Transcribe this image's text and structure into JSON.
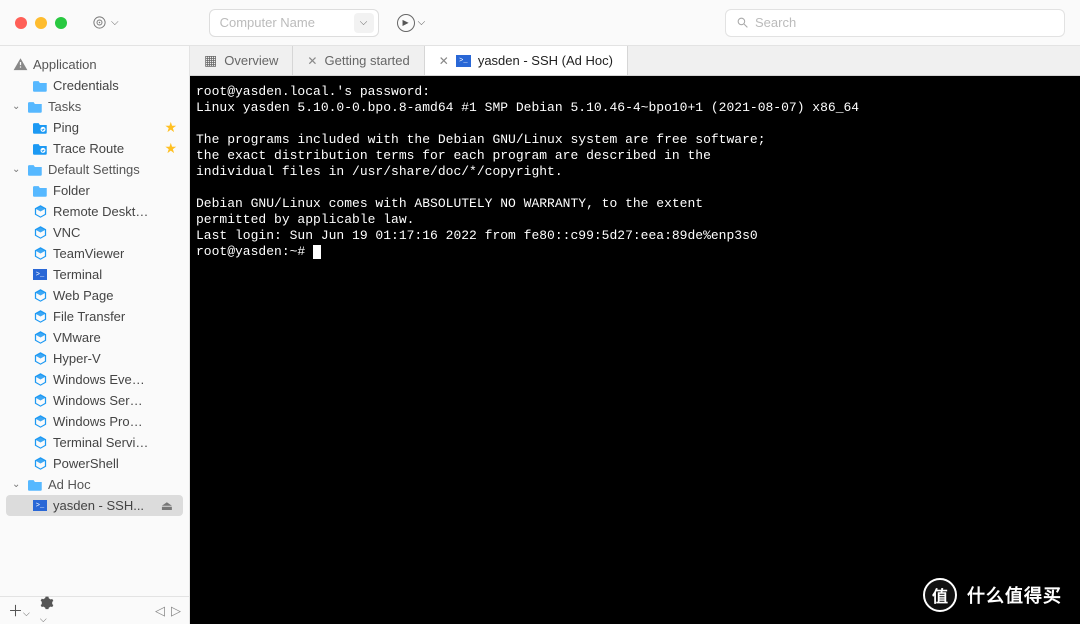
{
  "toolbar": {
    "name_placeholder": "Computer Name",
    "search_placeholder": "Search"
  },
  "sidebar": {
    "groups": [
      {
        "label": "Application",
        "icon": "warning",
        "children": [
          {
            "label": "Credentials",
            "icon": "folder"
          }
        ]
      },
      {
        "label": "Tasks",
        "icon": "folder",
        "children": [
          {
            "label": "Ping",
            "icon": "task",
            "starred": true
          },
          {
            "label": "Trace Route",
            "icon": "task",
            "starred": true
          }
        ]
      },
      {
        "label": "Default Settings",
        "icon": "folder",
        "children": [
          {
            "label": "Folder",
            "icon": "folder"
          },
          {
            "label": "Remote Desktop",
            "icon": "cube"
          },
          {
            "label": "VNC",
            "icon": "cube"
          },
          {
            "label": "TeamViewer",
            "icon": "cube"
          },
          {
            "label": "Terminal",
            "icon": "term"
          },
          {
            "label": "Web Page",
            "icon": "cube"
          },
          {
            "label": "File Transfer",
            "icon": "cube"
          },
          {
            "label": "VMware",
            "icon": "cube"
          },
          {
            "label": "Hyper-V",
            "icon": "cube"
          },
          {
            "label": "Windows Events...",
            "icon": "cube"
          },
          {
            "label": "Windows Services",
            "icon": "cube"
          },
          {
            "label": "Windows Proces...",
            "icon": "cube"
          },
          {
            "label": "Terminal Services",
            "icon": "cube"
          },
          {
            "label": "PowerShell",
            "icon": "cube"
          }
        ]
      },
      {
        "label": "Ad Hoc",
        "icon": "folder",
        "children": [
          {
            "label": "yasden - SSH...",
            "icon": "term",
            "selected": true,
            "removable": true
          }
        ]
      }
    ]
  },
  "tabs": [
    {
      "label": "Overview",
      "icon": "grid",
      "closable": false,
      "active": false
    },
    {
      "label": "Getting started",
      "icon": null,
      "closable": true,
      "active": false
    },
    {
      "label": "yasden - SSH (Ad Hoc)",
      "icon": "term",
      "closable": true,
      "active": true
    }
  ],
  "terminal": {
    "lines": [
      "root@yasden.local.'s password:",
      "Linux yasden 5.10.0-0.bpo.8-amd64 #1 SMP Debian 5.10.46-4~bpo10+1 (2021-08-07) x86_64",
      "",
      "The programs included with the Debian GNU/Linux system are free software;",
      "the exact distribution terms for each program are described in the",
      "individual files in /usr/share/doc/*/copyright.",
      "",
      "Debian GNU/Linux comes with ABSOLUTELY NO WARRANTY, to the extent",
      "permitted by applicable law.",
      "Last login: Sun Jun 19 01:17:16 2022 from fe80::c99:5d27:eea:89de%enp3s0"
    ],
    "prompt": "root@yasden:~# "
  },
  "watermark": {
    "badge": "值",
    "text": "什么值得买"
  }
}
